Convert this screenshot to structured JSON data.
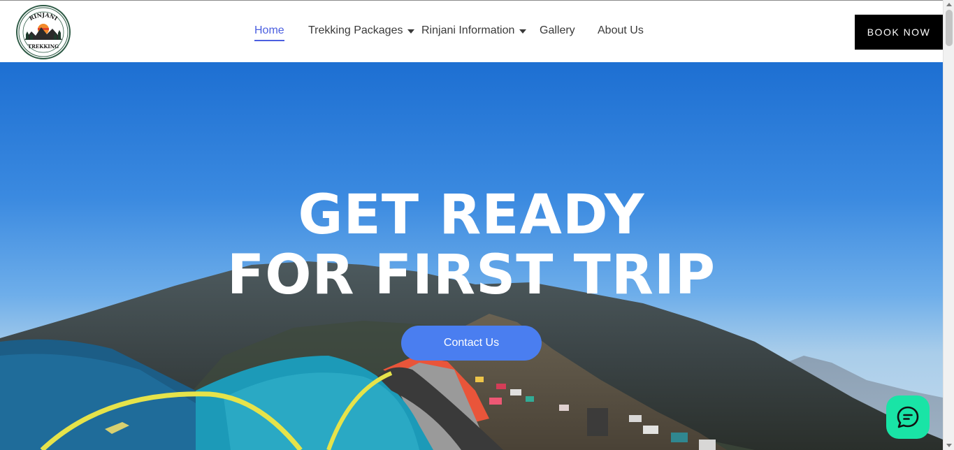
{
  "logo": {
    "top_text": "RINJANI",
    "bottom_text": "TREKKING"
  },
  "nav": {
    "items": [
      {
        "label": "Home",
        "active": true,
        "dropdown": false
      },
      {
        "label": "Trekking Packages",
        "active": false,
        "dropdown": true
      },
      {
        "label": "Rinjani Information",
        "active": false,
        "dropdown": true
      },
      {
        "label": "Gallery",
        "active": false,
        "dropdown": false
      },
      {
        "label": "About Us",
        "active": false,
        "dropdown": false
      }
    ],
    "active_color": "#4b5fe0",
    "dropdown_icon": "caret-down-icon"
  },
  "book_button": {
    "label": "BOOK NOW",
    "color": "#000000"
  },
  "hero": {
    "title_line1": "GET READY",
    "title_line2": "FOR FIRST TRIP",
    "cta_label": "Contact Us",
    "cta_color": "#4a7ef0",
    "background": "mountain-campsite-photo"
  },
  "chat_widget": {
    "icon": "chat-bubble-icon",
    "color": "#19e4a6"
  }
}
